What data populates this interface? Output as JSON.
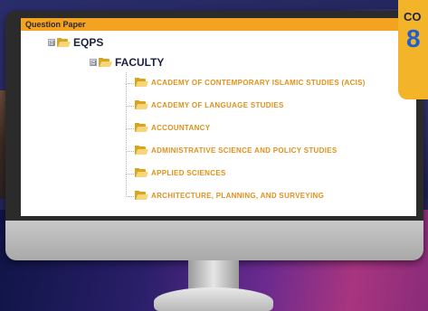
{
  "window": {
    "title": "Question Paper"
  },
  "tree": {
    "root": {
      "label": "EQPS",
      "toggle": "⊟"
    },
    "child": {
      "label": "FACULTY",
      "toggle": "⊟"
    },
    "items": [
      {
        "label": "ACADEMY OF CONTEMPORARY ISLAMIC STUDIES (ACIS)"
      },
      {
        "label": "ACADEMY OF LANGUAGE STUDIES"
      },
      {
        "label": "ACCOUNTANCY"
      },
      {
        "label": "ADMINISTRATIVE SCIENCE AND POLICY STUDIES"
      },
      {
        "label": "APPLIED SCIENCES"
      },
      {
        "label": "ARCHITECTURE, PLANNING, AND SURVEYING"
      }
    ]
  },
  "badge": {
    "top_text": "CO",
    "number": "8"
  },
  "colors": {
    "titlebar": "#f3a31f",
    "leaf_text": "#e2901a",
    "badge": "#f4b42a",
    "badge_number": "#1f5fd0"
  }
}
